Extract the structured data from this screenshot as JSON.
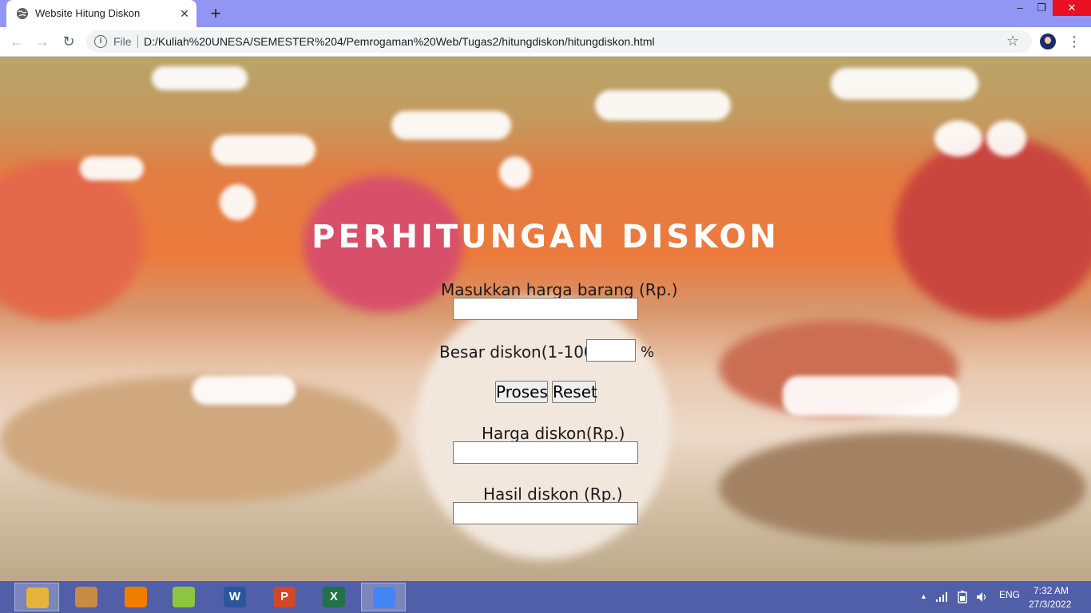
{
  "browser": {
    "tab_title": "Website Hitung Diskon",
    "tab_close_glyph": "✕",
    "new_tab_glyph": "+",
    "window_controls": {
      "minimize": "–",
      "maximize": "❐",
      "close": "✕"
    },
    "nav": {
      "back": "←",
      "forward": "→",
      "reload": "↻",
      "menu": "⋮",
      "star": "☆"
    },
    "address": {
      "scheme_label": "File",
      "url": "D:/Kuliah%20UNESA/SEMESTER%204/Pemrogaman%20Web/Tugas2/hitungdiskon/hitungdiskon.html"
    }
  },
  "page": {
    "title": "PERHITUNGAN DISKON",
    "form": {
      "price_label": "Masukkan harga barang (Rp.)",
      "price_value": "",
      "discount_label": "Besar diskon(1-100)",
      "discount_value": "",
      "percent_sign": "%",
      "process_button": "Proses",
      "reset_button": "Reset",
      "discounted_price_label": "Harga diskon(Rp.)",
      "discounted_price_value": "",
      "discount_result_label": "Hasil diskon (Rp.)",
      "discount_result_value": ""
    }
  },
  "taskbar": {
    "apps": [
      {
        "name": "file-explorer-icon",
        "glyph": "",
        "color": "#e7b23a",
        "active": true
      },
      {
        "name": "paint-icon",
        "glyph": "",
        "color": "#c98a44",
        "active": false
      },
      {
        "name": "vlc-icon",
        "glyph": "",
        "color": "#ef7d00",
        "active": false
      },
      {
        "name": "app-icon",
        "glyph": "",
        "color": "#8cc63f",
        "active": false
      },
      {
        "name": "word-icon",
        "glyph": "W",
        "color": "#2b579a",
        "active": false
      },
      {
        "name": "powerpoint-icon",
        "glyph": "P",
        "color": "#d24726",
        "active": false
      },
      {
        "name": "excel-icon",
        "glyph": "X",
        "color": "#217346",
        "active": false
      },
      {
        "name": "chrome-icon",
        "glyph": "",
        "color": "#4285f4",
        "active": true
      }
    ],
    "tray": {
      "chevron": "▲",
      "language": "ENG"
    },
    "clock": {
      "time": "7:32 AM",
      "date": "27/3/2022"
    }
  }
}
